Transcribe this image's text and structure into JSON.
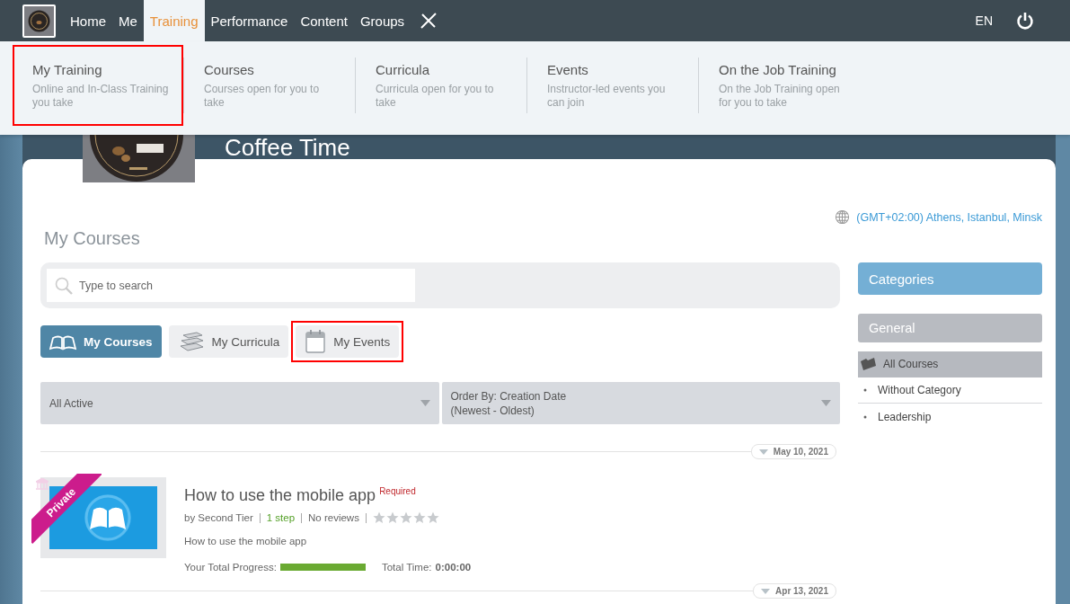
{
  "nav": {
    "items": [
      {
        "label": "Home",
        "selected": false
      },
      {
        "label": "Me",
        "selected": false
      },
      {
        "label": "Training",
        "selected": true
      },
      {
        "label": "Performance",
        "selected": false
      },
      {
        "label": "Content",
        "selected": false
      },
      {
        "label": "Groups",
        "selected": false
      }
    ],
    "language": "EN"
  },
  "mega_menu": {
    "items": [
      {
        "title": "My Training",
        "description": "Online and In-Class Training you take",
        "highlighted": true
      },
      {
        "title": "Courses",
        "description": "Courses open for you to take",
        "highlighted": false
      },
      {
        "title": "Curricula",
        "description": "Curricula open for you to take",
        "highlighted": false
      },
      {
        "title": "Events",
        "description": "Instructor-led events you can join",
        "highlighted": false
      },
      {
        "title": "On the Job Training",
        "description": "On the Job Training open for you to take",
        "highlighted": false
      }
    ]
  },
  "banner": {
    "title": "Coffee Time"
  },
  "timezone": "(GMT+02:00) Athens, Istanbul, Minsk",
  "page_title": "My Courses",
  "search": {
    "placeholder": "Type to search"
  },
  "tabs": [
    {
      "label": "My Courses",
      "kind": "courses",
      "selected": true,
      "highlighted": false
    },
    {
      "label": "My Curricula",
      "kind": "curricula",
      "selected": false,
      "highlighted": false
    },
    {
      "label": "My Events",
      "kind": "events",
      "selected": false,
      "highlighted": true
    }
  ],
  "filters": [
    {
      "lines": [
        "All Active"
      ]
    },
    {
      "lines": [
        "Order By: Creation Date",
        "(Newest - Oldest)"
      ]
    }
  ],
  "courses": [
    {
      "date": "May 10, 2021",
      "ribbon": "Private",
      "title": "How to use the mobile app",
      "badge": "Required",
      "meta": [
        {
          "text": "by Second Tier",
          "kind": "plain"
        },
        {
          "text": "1 step",
          "kind": "link"
        },
        {
          "text": "No reviews",
          "kind": "plain"
        }
      ],
      "stars": 0,
      "description": "How to use the mobile app",
      "progress_label": "Your Total Progress:",
      "level": 1,
      "time_label": "Total Time:",
      "time": "0:00:00"
    }
  ],
  "next_date": "Apr 13, 2021",
  "sidebar": {
    "heading": "Categories",
    "group": "General",
    "items": [
      {
        "label": "All Courses",
        "selected": true
      },
      {
        "label": "Without Category",
        "selected": false
      },
      {
        "label": "Leadership",
        "selected": false
      }
    ]
  }
}
